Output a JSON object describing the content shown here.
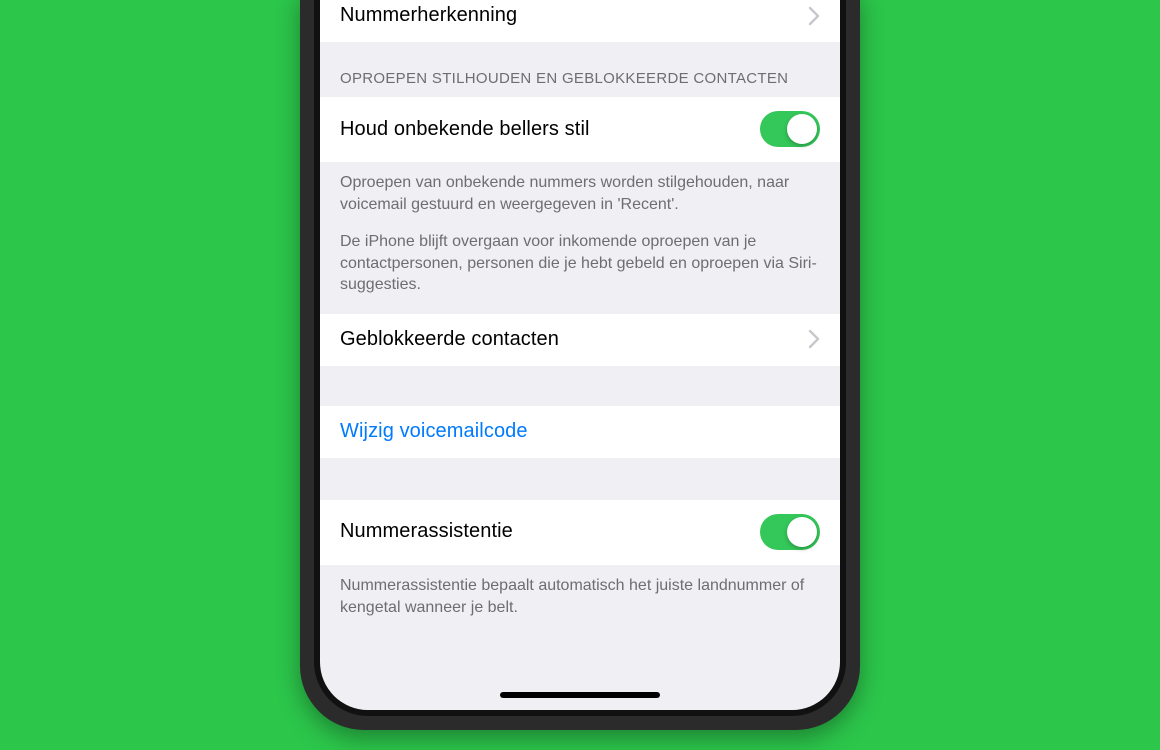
{
  "settings": {
    "numberId": {
      "label": "Nummerherkenning"
    },
    "silenceSection": {
      "header": "OPROEPEN STILHOUDEN EN GEBLOKKEERDE CONTACTEN",
      "toggleLabel": "Houd onbekende bellers stil",
      "toggleOn": true,
      "footer1": "Oproepen van onbekende nummers worden stilgehouden, naar voicemail gestuurd en weergegeven in 'Recent'.",
      "footer2": "De iPhone blijft overgaan voor inkomende oproepen van je contactpersonen, personen die je hebt gebeld en oproepen via Siri-suggesties."
    },
    "blocked": {
      "label": "Geblokkeerde contacten"
    },
    "voicemail": {
      "label": "Wijzig voicemailcode"
    },
    "assist": {
      "label": "Nummerassistentie",
      "toggleOn": true,
      "footer": "Nummerassistentie bepaalt automatisch het juiste landnummer of kengetal wanneer je belt."
    }
  }
}
